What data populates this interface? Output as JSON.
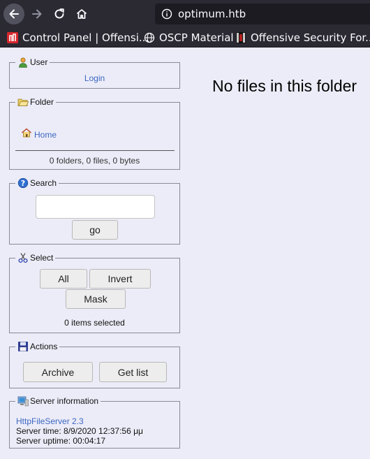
{
  "browser": {
    "url": "optimum.htb",
    "bookmarks": [
      {
        "label": "Control Panel | Offensi..."
      },
      {
        "label": "OSCP Material"
      },
      {
        "label": "Offensive Security For..."
      }
    ]
  },
  "user": {
    "legend": "User",
    "login_label": "Login"
  },
  "folder": {
    "legend": "Folder",
    "home_label": "Home",
    "summary": "0 folders, 0 files, 0 bytes"
  },
  "search": {
    "legend": "Search",
    "query": "",
    "go_label": "go"
  },
  "select": {
    "legend": "Select",
    "all_label": "All",
    "invert_label": "Invert",
    "mask_label": "Mask",
    "status": "0 items selected"
  },
  "actions": {
    "legend": "Actions",
    "archive_label": "Archive",
    "getlist_label": "Get list"
  },
  "server": {
    "legend": "Server information",
    "software": "HttpFileServer 2.3",
    "time": "Server time: 8/9/2020 12:37:56 μμ",
    "uptime": "Server uptime: 00:04:17"
  },
  "main": {
    "empty_message": "No files in this folder"
  }
}
